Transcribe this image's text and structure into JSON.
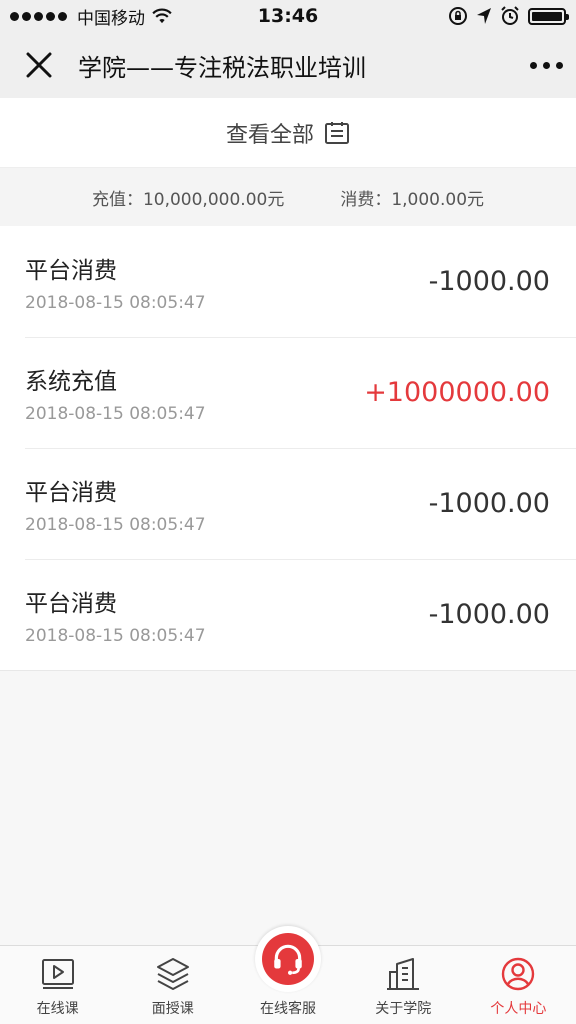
{
  "status_bar": {
    "carrier": "中国移动",
    "time": "13:46"
  },
  "nav": {
    "title": "学院——专注税法职业培训"
  },
  "view_all": {
    "label": "查看全部"
  },
  "summary": {
    "recharge_label": "充值：",
    "recharge_value": "10,000,000.00元",
    "spend_label": "消费：",
    "spend_value": "1,000.00元"
  },
  "records": [
    {
      "title": "平台消费",
      "time": "2018-08-15 08:05:47",
      "amount": "-1000.00",
      "positive": false
    },
    {
      "title": "系统充值",
      "time": "2018-08-15 08:05:47",
      "amount": "+1000000.00",
      "positive": true
    },
    {
      "title": "平台消费",
      "time": "2018-08-15 08:05:47",
      "amount": "-1000.00",
      "positive": false
    },
    {
      "title": "平台消费",
      "time": "2018-08-15 08:05:47",
      "amount": "-1000.00",
      "positive": false
    }
  ],
  "tabs": [
    {
      "label": "在线课",
      "icon": "video-icon",
      "active": false
    },
    {
      "label": "面授课",
      "icon": "layers-icon",
      "active": false
    },
    {
      "label": "在线客服",
      "icon": "headset-icon",
      "active": false
    },
    {
      "label": "关于学院",
      "icon": "building-icon",
      "active": false
    },
    {
      "label": "个人中心",
      "icon": "user-icon",
      "active": true
    }
  ],
  "colors": {
    "accent": "#e4393c",
    "text": "#333333",
    "muted": "#999999"
  }
}
